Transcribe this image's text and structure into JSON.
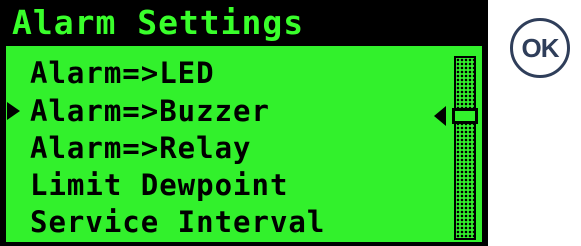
{
  "screen": {
    "title": "Alarm Settings",
    "menu_items": [
      {
        "label": "Alarm=>LED"
      },
      {
        "label": "Alarm=>Buzzer"
      },
      {
        "label": "Alarm=>Relay"
      },
      {
        "label": "Limit Dewpoint"
      },
      {
        "label": "Service Interval"
      }
    ],
    "selected_index": 1
  },
  "ok_button": {
    "label": "OK"
  },
  "colors": {
    "lcd_green": "#32f12c",
    "title_green": "#39ff2b",
    "background": "#000000",
    "button_outline": "#2f3e5a"
  }
}
